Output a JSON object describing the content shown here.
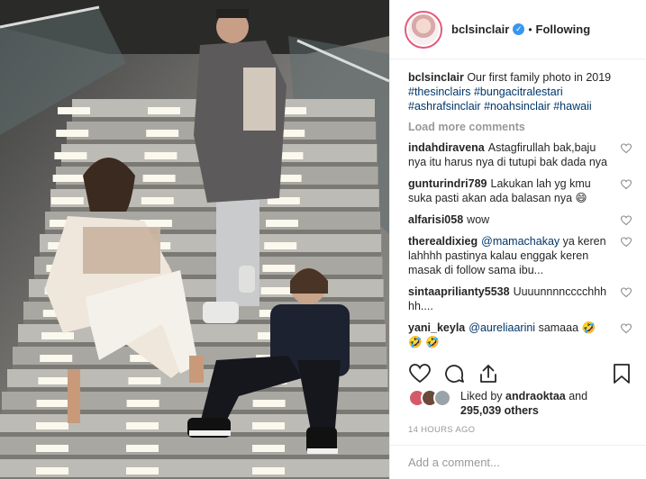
{
  "post": {
    "username": "bclsinclair",
    "verified_mark": "✓",
    "separator": "•",
    "follow_status": "Following"
  },
  "caption": {
    "username": "bclsinclair",
    "text": "Our first family photo in 2019",
    "hashtags": [
      "#thesinclairs",
      "#bungacitralestari",
      "#ashrafsinclair",
      "#noahsinclair",
      "#hawaii"
    ]
  },
  "load_more": "Load more comments",
  "comments": [
    {
      "user": "indahdiravena",
      "text": "Astagfirullah bak,baju nya itu harus nya di tutupi bak dada nya",
      "mention": ""
    },
    {
      "user": "gunturindri789",
      "text": "Lakukan lah yg kmu suka pasti akan ada balasan nya 😄",
      "mention": ""
    },
    {
      "user": "alfarisi058",
      "text": "wow",
      "mention": ""
    },
    {
      "user": "therealdixieg",
      "mention": "@mamachakay",
      "text": " ya keren lahhhh pastinya kalau enggak keren masak di follow sama ibu..."
    },
    {
      "user": "sintaaprilianty5538",
      "text": "Uuuunnnncccchhh hh....",
      "mention": ""
    },
    {
      "user": "yani_keyla",
      "mention": "@aureliaarini",
      "text": " samaaa 🤣 🤣 🤣"
    }
  ],
  "likes": {
    "prefix": "Liked by",
    "user": "andraoktaa",
    "and": "and",
    "count": "295,039 others"
  },
  "timestamp": "14 HOURS AGO",
  "add_comment": {
    "placeholder": "Add a comment..."
  },
  "icons": {
    "like": "heart-icon",
    "comment": "comment-icon",
    "share": "share-icon",
    "save": "bookmark-icon",
    "comment_like": "small-heart-icon"
  },
  "colors": {
    "link": "#003569",
    "verified": "#3897f0",
    "muted": "#999999",
    "text": "#262626"
  },
  "photo": {
    "censor_block_color": "#c9b5a0"
  }
}
